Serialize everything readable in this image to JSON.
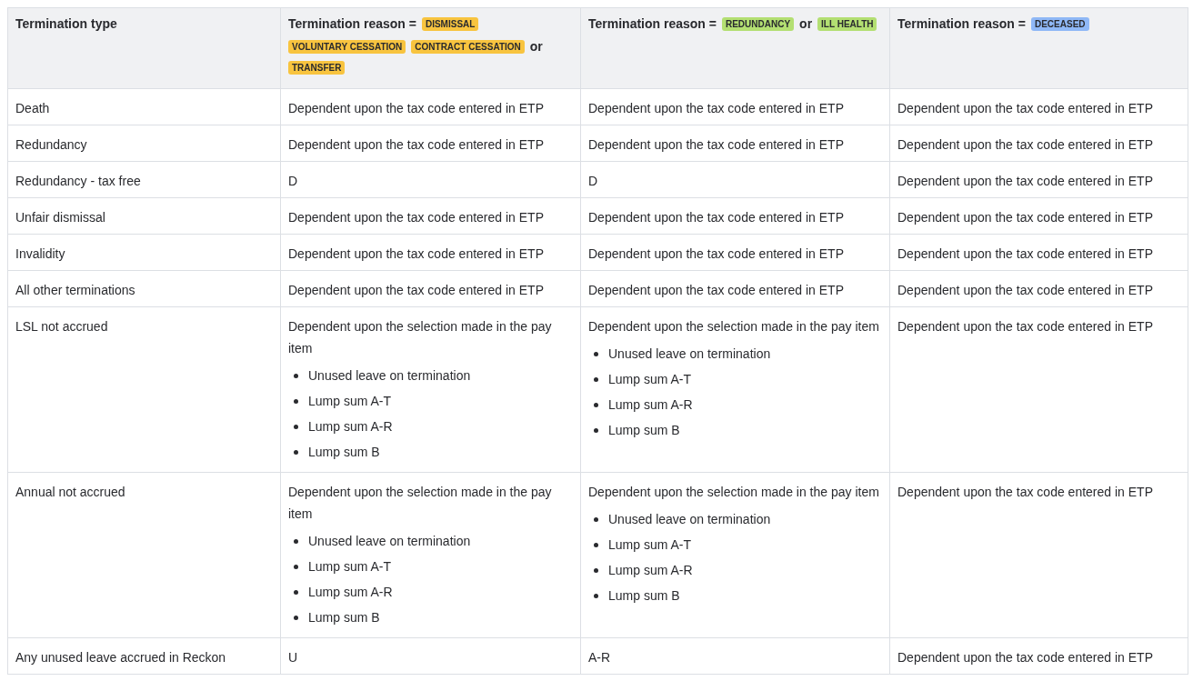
{
  "table": {
    "columns": [
      {
        "parts": [
          {
            "kind": "text",
            "text": "Termination type"
          }
        ]
      },
      {
        "parts": [
          {
            "kind": "text",
            "text": "Termination reason ="
          },
          {
            "kind": "lozenge",
            "text": "DISMISSAL",
            "color": "#f8c43f"
          },
          {
            "kind": "lozenge",
            "text": "VOLUNTARY CESSATION",
            "color": "#f8c43f"
          },
          {
            "kind": "lozenge",
            "text": "CONTRACT CESSATION",
            "color": "#f8c43f"
          },
          {
            "kind": "text",
            "text": "or"
          },
          {
            "kind": "lozenge",
            "text": "TRANSFER",
            "color": "#f8c43f"
          }
        ]
      },
      {
        "parts": [
          {
            "kind": "text",
            "text": "Termination reason ="
          },
          {
            "kind": "lozenge",
            "text": "REDUNDANCY",
            "color": "#b3df72"
          },
          {
            "kind": "text",
            "text": "or"
          },
          {
            "kind": "lozenge",
            "text": "ILL HEALTH",
            "color": "#b3df72"
          }
        ]
      },
      {
        "parts": [
          {
            "kind": "text",
            "text": "Termination reason ="
          },
          {
            "kind": "lozenge",
            "text": "DECEASED",
            "color": "#8fb8f6"
          }
        ]
      }
    ],
    "rows": [
      {
        "cells": [
          {
            "text": "Death"
          },
          {
            "text": "Dependent upon the tax code entered in ETP"
          },
          {
            "text": "Dependent upon the tax code entered in ETP"
          },
          {
            "text": "Dependent upon the tax code entered in ETP"
          }
        ]
      },
      {
        "cells": [
          {
            "text": "Redundancy"
          },
          {
            "text": "Dependent upon the tax code entered in ETP"
          },
          {
            "text": "Dependent upon the tax code entered in ETP"
          },
          {
            "text": "Dependent upon the tax code entered in ETP"
          }
        ]
      },
      {
        "cells": [
          {
            "text": "Redundancy - tax free"
          },
          {
            "text": "D"
          },
          {
            "text": "D"
          },
          {
            "text": "Dependent upon the tax code entered in ETP"
          }
        ]
      },
      {
        "cells": [
          {
            "text": "Unfair dismissal"
          },
          {
            "text": "Dependent upon the tax code entered in ETP"
          },
          {
            "text": "Dependent upon the tax code entered in ETP"
          },
          {
            "text": "Dependent upon the tax code entered in ETP"
          }
        ]
      },
      {
        "cells": [
          {
            "text": "Invalidity"
          },
          {
            "text": "Dependent upon the tax code entered in ETP"
          },
          {
            "text": "Dependent upon the tax code entered in ETP"
          },
          {
            "text": "Dependent upon the tax code entered in ETP"
          }
        ]
      },
      {
        "cells": [
          {
            "text": "All other terminations"
          },
          {
            "text": "Dependent upon the tax code entered in ETP"
          },
          {
            "text": "Dependent upon the tax code entered in ETP"
          },
          {
            "text": "Dependent upon the tax code entered in ETP"
          }
        ]
      },
      {
        "cells": [
          {
            "text": "LSL not accrued"
          },
          {
            "text": "Dependent upon the selection made in the pay item",
            "bullets": [
              "Unused leave on termination",
              "Lump sum A-T",
              "Lump sum A-R",
              "Lump sum B"
            ]
          },
          {
            "text": "Dependent upon the selection made in the pay item",
            "bullets": [
              "Unused leave on termination",
              "Lump sum A-T",
              "Lump sum A-R",
              "Lump sum B"
            ]
          },
          {
            "text": "Dependent upon the tax code entered in ETP"
          }
        ]
      },
      {
        "cells": [
          {
            "text": "Annual not accrued"
          },
          {
            "text": "Dependent upon the selection made in the pay item",
            "bullets": [
              "Unused leave on termination",
              "Lump sum A-T",
              "Lump sum A-R",
              "Lump sum B"
            ]
          },
          {
            "text": "Dependent upon the selection made in the pay item",
            "bullets": [
              "Unused leave on termination",
              "Lump sum A-T",
              "Lump sum A-R",
              "Lump sum B"
            ]
          },
          {
            "text": "Dependent upon the tax code entered in ETP"
          }
        ]
      },
      {
        "cells": [
          {
            "text": "Any unused leave accrued in Reckon"
          },
          {
            "text": "U"
          },
          {
            "text": "A-R"
          },
          {
            "text": "Dependent upon the tax code entered in ETP"
          }
        ]
      }
    ]
  }
}
